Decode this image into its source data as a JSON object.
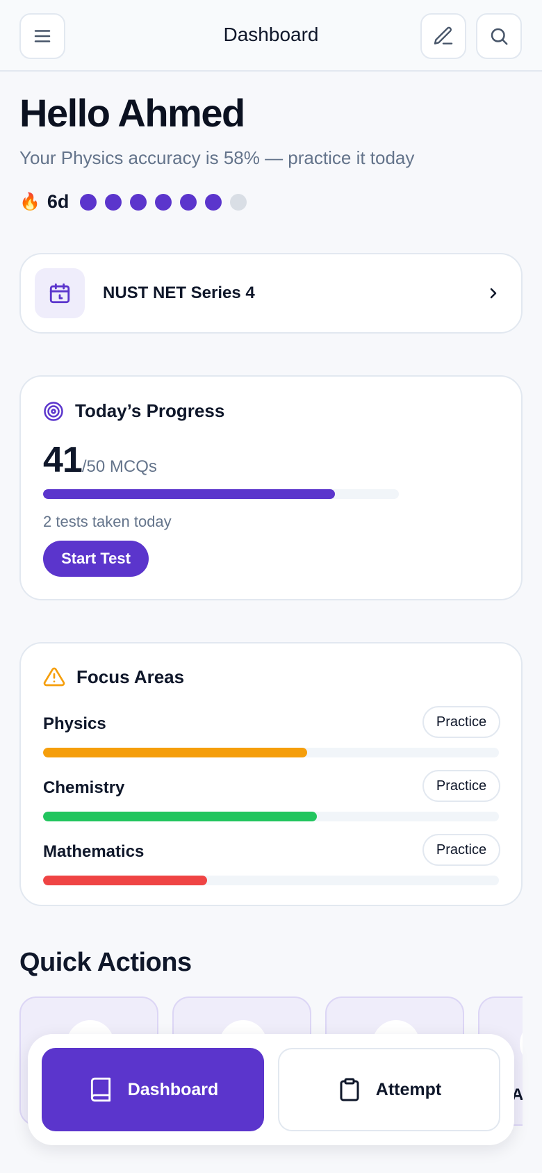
{
  "header": {
    "title": "Dashboard",
    "icons": [
      "menu-icon",
      "pencil-icon",
      "search-icon"
    ]
  },
  "greeting": {
    "title": "Hello Ahmed",
    "subtitle": "Your Physics accuracy is 58% — practice it today"
  },
  "streak": {
    "emoji": "🔥",
    "days": "6d",
    "completed": 6,
    "total": 7
  },
  "next_test": {
    "label": "NUST NET Series 4",
    "icon": "calendar-icon"
  },
  "progress": {
    "title": "Today’s Progress",
    "done": "41",
    "goal_text": "/50 MCQs",
    "fraction": 0.82,
    "tests_note": "2 tests taken today",
    "button": "Start Test"
  },
  "focus": {
    "title": "Focus Areas",
    "practice_label": "Practice",
    "subjects": [
      {
        "name": "Physics",
        "level": 0.58,
        "color": "#f59e0b"
      },
      {
        "name": "Chemistry",
        "level": 0.6,
        "color": "#22c55e"
      },
      {
        "name": "Mathematics",
        "level": 0.36,
        "color": "#ef4444"
      }
    ]
  },
  "quick_actions": {
    "title": "Quick Actions",
    "peek_text": "At"
  },
  "nav": {
    "dashboard": "Dashboard",
    "attempt": "Attempt"
  },
  "colors": {
    "accent": "#5b35cc",
    "muted": "#64748b",
    "inactive_dot": "#d9dee5"
  }
}
